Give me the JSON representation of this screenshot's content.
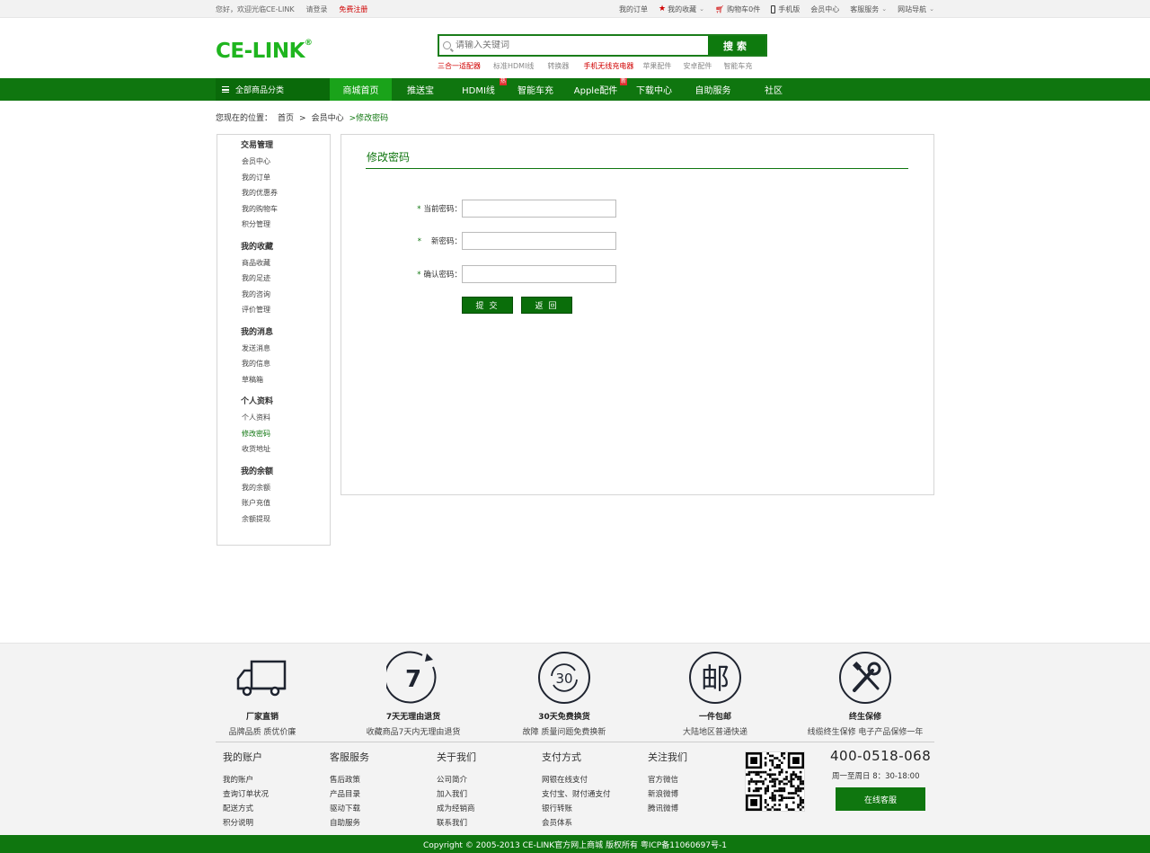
{
  "topbar": {
    "greeting": "您好，欢迎光临CE-LINK",
    "login": "请登录",
    "register": "免费注册",
    "my_orders": "我的订单",
    "favorites": "我的收藏",
    "cart": "购物车0件",
    "mobile": "手机版",
    "member_center": "会员中心",
    "customer_service": "客服服务",
    "site_nav": "网站导航"
  },
  "header": {
    "logo": "CE-LINK",
    "logo_mark": "®",
    "search_placeholder": "请输入关键词",
    "search_button": "搜索",
    "hot_words": [
      {
        "label": "三合一适配器",
        "hot": true
      },
      {
        "label": "标准HDMI线",
        "hot": false
      },
      {
        "label": "转换器",
        "hot": false
      },
      {
        "label": "手机无线充电器",
        "hot": true
      },
      {
        "label": "苹果配件",
        "hot": false
      },
      {
        "label": "安卓配件",
        "hot": false
      },
      {
        "label": "智能车充",
        "hot": false
      }
    ]
  },
  "nav": {
    "all_categories": "全部商品分类",
    "items": [
      {
        "label": "商城首页",
        "active": true,
        "badge": ""
      },
      {
        "label": "推送宝",
        "active": false,
        "badge": ""
      },
      {
        "label": "HDMI线",
        "active": false,
        "badge": "热"
      },
      {
        "label": "智能车充",
        "active": false,
        "badge": ""
      },
      {
        "label": "Apple配件",
        "active": false,
        "badge": "新"
      },
      {
        "label": "下载中心",
        "active": false,
        "badge": ""
      },
      {
        "label": "自助服务",
        "active": false,
        "badge": ""
      },
      {
        "label": "社区",
        "active": false,
        "badge": ""
      }
    ]
  },
  "breadcrumb": {
    "prefix": "您现在的位置：",
    "home": "首页",
    "sep1": ">",
    "member": "会员中心",
    "current": ">修改密码"
  },
  "sidebar": {
    "groups": [
      {
        "title": "交易管理",
        "items": [
          "会员中心",
          "我的订单",
          "我的优惠券",
          "我的购物车",
          "积分管理"
        ]
      },
      {
        "title": "我的收藏",
        "items": [
          "商品收藏",
          "我的足迹",
          "我的咨询",
          "评价管理"
        ]
      },
      {
        "title": "我的消息",
        "items": [
          "发送消息",
          "我的信息",
          "草稿箱"
        ]
      },
      {
        "title": "个人资料",
        "items": [
          "个人资料",
          "修改密码",
          "收货地址"
        ]
      },
      {
        "title": "我的余额",
        "items": [
          "我的余额",
          "账户充值",
          "余额提现"
        ]
      }
    ],
    "active_item": "修改密码"
  },
  "form": {
    "title": "修改密码",
    "required_mark": "*",
    "current_password_label": "当前密码：",
    "new_password_label": "新密码：",
    "confirm_password_label": "确认密码：",
    "submit": "提交",
    "back": "返回"
  },
  "features": [
    {
      "icon": "truck-icon",
      "title": "厂家直销",
      "subtitle": "品牌品质  质优价廉"
    },
    {
      "icon": "seven-day-return-icon",
      "title": "7天无理由退货",
      "subtitle": "收藏商品7天内无理由退货",
      "glyph": "7"
    },
    {
      "icon": "thirty-day-exchange-icon",
      "title": "30天免费换货",
      "subtitle": "故障 质量问题免费换新",
      "glyph": "30"
    },
    {
      "icon": "postal-icon",
      "title": "一件包邮",
      "subtitle": "大陆地区普通快递",
      "glyph": "邮"
    },
    {
      "icon": "tools-icon",
      "title": "终生保修",
      "subtitle": "线缆终生保修  电子产品保修一年"
    }
  ],
  "footer_links": [
    {
      "heading": "我的账户",
      "links": [
        "我的账户",
        "查询订单状况",
        "配送方式",
        "积分说明"
      ]
    },
    {
      "heading": "客服服务",
      "links": [
        "售后政策",
        "产品目录",
        "驱动下载",
        "自助服务"
      ]
    },
    {
      "heading": "关于我们",
      "links": [
        "公司简介",
        "加入我们",
        "成为经销商",
        "联系我们"
      ]
    },
    {
      "heading": "支付方式",
      "links": [
        "网银在线支付",
        "支付宝、财付通支付",
        "银行转账",
        "会员体系"
      ]
    },
    {
      "heading": "关注我们",
      "links": [
        "官方微信",
        "新浪微博",
        "腾讯微博"
      ]
    }
  ],
  "contact": {
    "hotline": "400-0518-068",
    "hours": "周一至周日   8：30-18:00",
    "online_service": "在线客服"
  },
  "copyright": "Copyright © 2005-2013 CE-LINK官方网上商城 版权所有 粤ICP备11060697号-1",
  "colors": {
    "brand_green": "#0f760f",
    "logo_green": "#1fb51f",
    "hot_red": "#d00000"
  }
}
